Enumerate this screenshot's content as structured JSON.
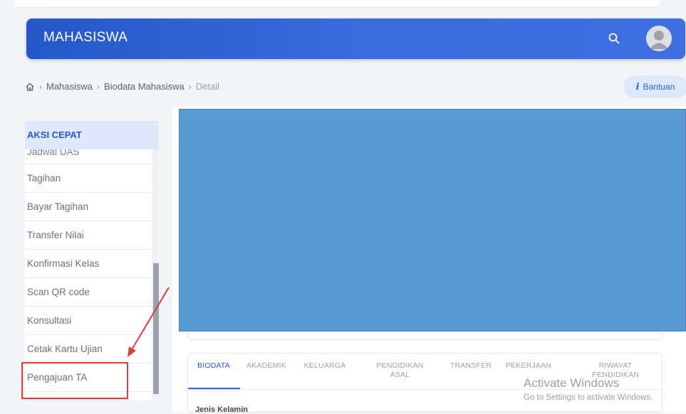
{
  "header": {
    "title": "MAHASISWA"
  },
  "breadcrumb": {
    "items": [
      "Mahasiswa",
      "Biodata Mahasiswa",
      "Detail"
    ]
  },
  "help": {
    "label": "Bantuan"
  },
  "sidebar": {
    "title": "AKSI CEPAT",
    "items": [
      {
        "label": "Jadwal UAS"
      },
      {
        "label": "Tagihan"
      },
      {
        "label": "Bayar Tagihan"
      },
      {
        "label": "Transfer Nilai"
      },
      {
        "label": "Konfirmasi Kelas"
      },
      {
        "label": "Scan QR code"
      },
      {
        "label": "Konsultasi"
      },
      {
        "label": "Cetak Kartu Ujian"
      },
      {
        "label": "Pengajuan TA"
      }
    ]
  },
  "tabs": [
    {
      "label": "BIODATA",
      "active": true
    },
    {
      "label": "AKADEMIK"
    },
    {
      "label": "KELUARGA"
    },
    {
      "label": "PENDIDIKAN ASAL"
    },
    {
      "label": "TRANSFER"
    },
    {
      "label": "PEKERJAAN"
    },
    {
      "label": "RIWAYAT PENDIDIKAN"
    }
  ],
  "content": {
    "first_field_label": "Jenis Kelamin"
  },
  "watermark": {
    "line1": "Activate Windows",
    "line2": "Go to Settings to activate Windows."
  },
  "icons": {
    "home": "home-icon",
    "search": "search-icon",
    "avatar": "user-avatar-icon",
    "info": "info-icon"
  },
  "colors": {
    "header_blue": "#2458c8",
    "accent_blue": "#2f63d6",
    "redaction_blue": "#5b9bd5",
    "annotation_red": "#e23b3b"
  }
}
